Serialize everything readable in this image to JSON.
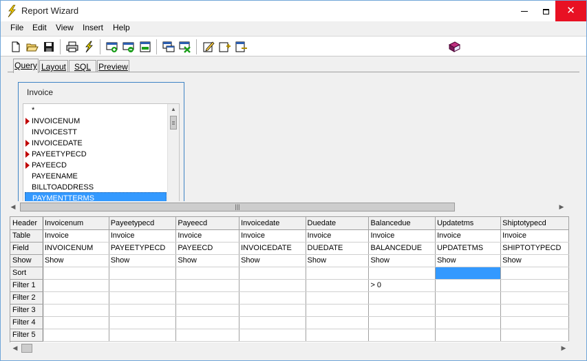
{
  "window": {
    "title": "Report Wizard"
  },
  "menu": [
    "File",
    "Edit",
    "View",
    "Insert",
    "Help"
  ],
  "toolbar": {
    "buttons": [
      {
        "name": "new-icon"
      },
      {
        "name": "open-icon"
      },
      {
        "name": "save-icon"
      },
      {
        "name": "print-icon"
      },
      {
        "name": "run-icon"
      },
      {
        "name": "add-row-icon"
      },
      {
        "name": "remove-row-icon"
      },
      {
        "name": "table-row-icon"
      },
      {
        "name": "add-table-icon"
      },
      {
        "name": "delete-table-icon"
      },
      {
        "name": "edit-icon"
      },
      {
        "name": "insert-field-icon"
      },
      {
        "name": "export-field-icon"
      },
      {
        "name": "help-book-icon"
      }
    ]
  },
  "tabs": [
    "Query",
    "Layout",
    "SQL",
    "Preview"
  ],
  "active_tab": "Query",
  "table_box": {
    "title": "Invoice",
    "fields": [
      {
        "label": "*",
        "key": false
      },
      {
        "label": "INVOICENUM",
        "key": true
      },
      {
        "label": "INVOICESTT",
        "key": false
      },
      {
        "label": "INVOICEDATE",
        "key": true
      },
      {
        "label": "PAYEETYPECD",
        "key": true
      },
      {
        "label": "PAYEECD",
        "key": true
      },
      {
        "label": "PAYEENAME",
        "key": false
      },
      {
        "label": "BILLTOADDRESS",
        "key": false
      },
      {
        "label": "PAYMENTTERMS",
        "key": false,
        "selected": true
      }
    ]
  },
  "grid": {
    "row_headers": [
      "Header",
      "Table",
      "Field",
      "Show",
      "Sort",
      "Filter 1",
      "Filter 2",
      "Filter 3",
      "Filter 4",
      "Filter 5"
    ],
    "columns": [
      {
        "header": "Invoicenum",
        "table": "Invoice",
        "field": "INVOICENUM",
        "show": "Show",
        "sort": "",
        "filter1": ""
      },
      {
        "header": "Payeetypecd",
        "table": "Invoice",
        "field": "PAYEETYPECD",
        "show": "Show",
        "sort": "",
        "filter1": ""
      },
      {
        "header": "Payeecd",
        "table": "Invoice",
        "field": "PAYEECD",
        "show": "Show",
        "sort": "",
        "filter1": ""
      },
      {
        "header": "Invoicedate",
        "table": "Invoice",
        "field": "INVOICEDATE",
        "show": "Show",
        "sort": "",
        "filter1": ""
      },
      {
        "header": "Duedate",
        "table": "Invoice",
        "field": "DUEDATE",
        "show": "Show",
        "sort": "",
        "filter1": ""
      },
      {
        "header": "Balancedue",
        "table": "Invoice",
        "field": "BALANCEDUE",
        "show": "Show",
        "sort": "",
        "filter1": "> 0"
      },
      {
        "header": "Updatetms",
        "table": "Invoice",
        "field": "UPDATETMS",
        "show": "Show",
        "sort": "",
        "filter1": ""
      },
      {
        "header": "Shiptotypecd",
        "table": "Invoice",
        "field": "SHIPTOTYPECD",
        "show": "Show",
        "sort": "",
        "filter1": ""
      }
    ],
    "selected_cell": {
      "row": "Sort",
      "column": "Updatetms"
    }
  },
  "colors": {
    "selection": "#3399ff",
    "close_button": "#e81123",
    "key_marker": "#c00000",
    "table_box_border": "#3c82c4"
  }
}
